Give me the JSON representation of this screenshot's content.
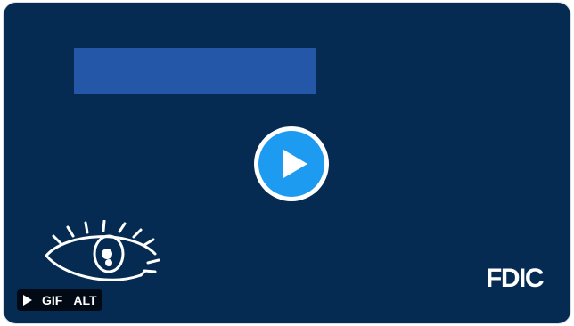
{
  "media": {
    "brand": "FDIC",
    "badges": {
      "play_icon": "play-icon",
      "gif_label": "GIF",
      "alt_label": "ALT"
    },
    "play_button_icon": "play-circle-icon",
    "logo_icon": "eye-icon"
  },
  "colors": {
    "background": "#052b52",
    "banner": "#2457a8",
    "play_accent": "#1d9bf0"
  }
}
